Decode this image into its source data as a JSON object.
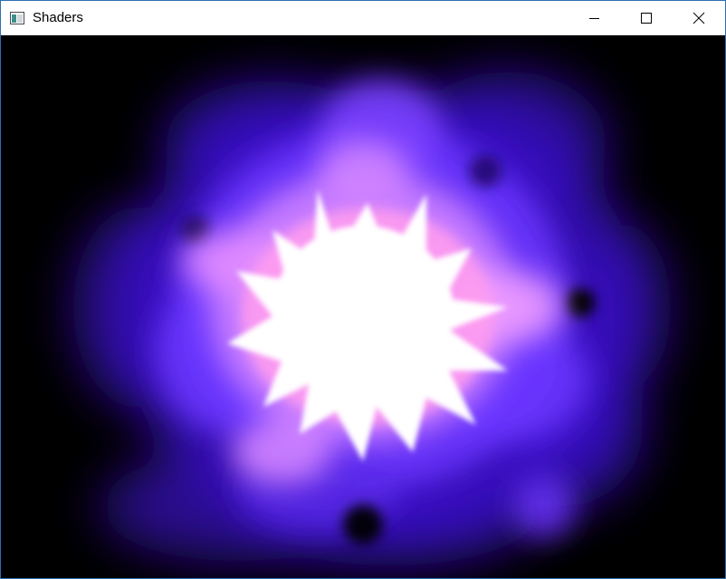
{
  "window": {
    "title": "Shaders",
    "app_icon": "window-app-icon",
    "controls": [
      {
        "name": "minimize-button",
        "icon": "minimize-icon"
      },
      {
        "name": "maximize-button",
        "icon": "maximize-icon"
      },
      {
        "name": "close-button",
        "icon": "close-icon"
      }
    ]
  },
  "render": {
    "background": "#000000",
    "glow_colors": [
      "#ffffff",
      "#ff9cf0",
      "#c97dff",
      "#6a35ff",
      "#3a12c8"
    ]
  }
}
